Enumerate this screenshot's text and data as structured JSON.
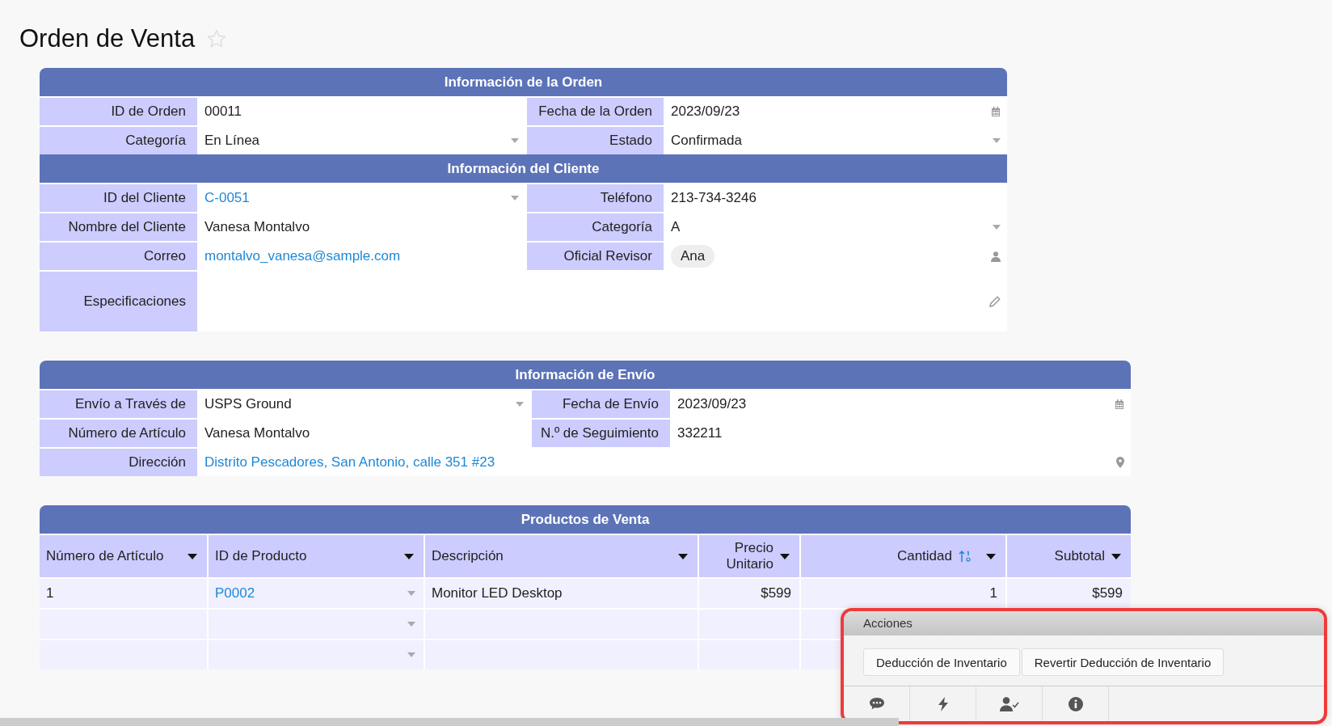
{
  "page_title": "Orden de Venta",
  "starred": false,
  "sections": [
    {
      "title": "Información de la Orden",
      "rows": [
        [
          {
            "label": "ID de Orden",
            "value": "00011",
            "kind": "text"
          },
          {
            "label": "Fecha de la Orden",
            "value": "2023/09/23",
            "kind": "date"
          }
        ],
        [
          {
            "label": "Categoría",
            "value": "En Línea",
            "kind": "select"
          },
          {
            "label": "Estado",
            "value": "Confirmada",
            "kind": "select"
          }
        ]
      ]
    },
    {
      "title": "Información del Cliente",
      "rows": [
        [
          {
            "label": "ID del Cliente",
            "value": "C-0051",
            "kind": "link_select"
          },
          {
            "label": "Teléfono",
            "value": "213-734-3246",
            "kind": "text"
          }
        ],
        [
          {
            "label": "Nombre del Cliente",
            "value": "Vanesa Montalvo",
            "kind": "text"
          },
          {
            "label": "Categoría",
            "value": "A",
            "kind": "select"
          }
        ],
        [
          {
            "label": "Correo",
            "value": "montalvo_vanesa@sample.com",
            "kind": "link"
          },
          {
            "label": "Oficial Revisor",
            "value": "Ana",
            "kind": "user"
          }
        ],
        [
          {
            "label": "Especificaciones",
            "kind": "note"
          }
        ]
      ]
    }
  ],
  "shipping": {
    "title": "Información de Envío",
    "rows": [
      [
        {
          "label": "Envío a Través de",
          "value": "USPS Ground",
          "kind": "select"
        },
        {
          "label": "Fecha de Envío",
          "value": "2023/09/23",
          "kind": "date"
        }
      ],
      [
        {
          "label": "Número de Artículo",
          "value": "Vanesa Montalvo",
          "kind": "text"
        },
        {
          "label": "N.º de Seguimiento",
          "value": "332211",
          "kind": "text"
        }
      ],
      [
        {
          "label": "Dirección",
          "value": "Distrito Pescadores, San Antonio, calle 351 #23",
          "kind": "address"
        }
      ]
    ]
  },
  "products": {
    "title": "Productos de Venta",
    "columns": [
      {
        "label": "Número de Artículo",
        "kind": "text",
        "sorted": false
      },
      {
        "label": "ID de Producto",
        "kind": "link_select",
        "sorted": false
      },
      {
        "label": "Descripción",
        "kind": "text",
        "sorted": false
      },
      {
        "label": "Precio Unitario",
        "kind": "number",
        "sorted": false
      },
      {
        "label": "Cantidad",
        "kind": "number",
        "sorted": true
      },
      {
        "label": "Subtotal",
        "kind": "number",
        "sorted": false
      }
    ],
    "rows": [
      {
        "cells": [
          "1",
          "P0002",
          "Monitor LED Desktop",
          "$599",
          "1",
          "$599"
        ]
      },
      {
        "cells": [
          null,
          null,
          null,
          null,
          null,
          null
        ]
      },
      {
        "cells": [
          null,
          null,
          null,
          null,
          null,
          null
        ]
      }
    ]
  },
  "actions": {
    "title": "Acciones",
    "highlighted": true,
    "buttons": [
      "Deducción de Inventario",
      "Revertir Deducción de Inventario"
    ]
  }
}
